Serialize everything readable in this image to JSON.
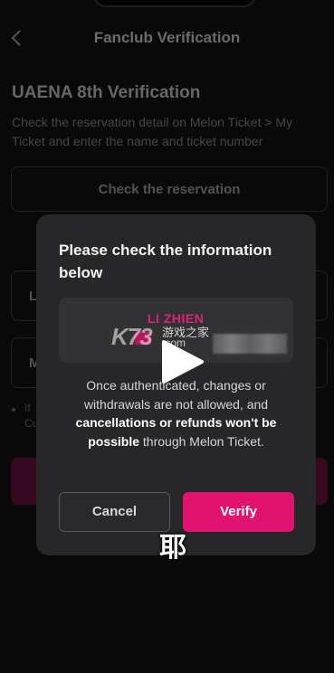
{
  "header": {
    "back_icon": "chevron-left-icon",
    "title": "Fanclub Verification"
  },
  "verification": {
    "title": "UAENA 8th Verification",
    "description": "Check the reservation detail on Melon Ticket > My Ticket and enter the name and ticket number",
    "check_button": "Check the reservation",
    "field_name_label": "L",
    "field_number_label": "M",
    "note": "If",
    "note_line2": "Cu"
  },
  "modal": {
    "title": "Please check the information below",
    "info_name": "LI ZHIEN",
    "message_part1": "Once authenticated, changes or withdrawals are not allowed, and ",
    "message_bold1": "cancellations or refunds won't be possible",
    "message_part2": " through Melon Ticket.",
    "cancel_label": "Cancel",
    "verify_label": "Verify"
  },
  "overlay": {
    "watermark_logo": "K73",
    "watermark_cn": "游戏之家",
    "watermark_domain": ".com",
    "play_icon": "play-icon",
    "subtitle": "耶"
  },
  "colors": {
    "accent": "#e2136e",
    "modal_bg": "#272628",
    "page_bg": "#0d0c0e"
  }
}
